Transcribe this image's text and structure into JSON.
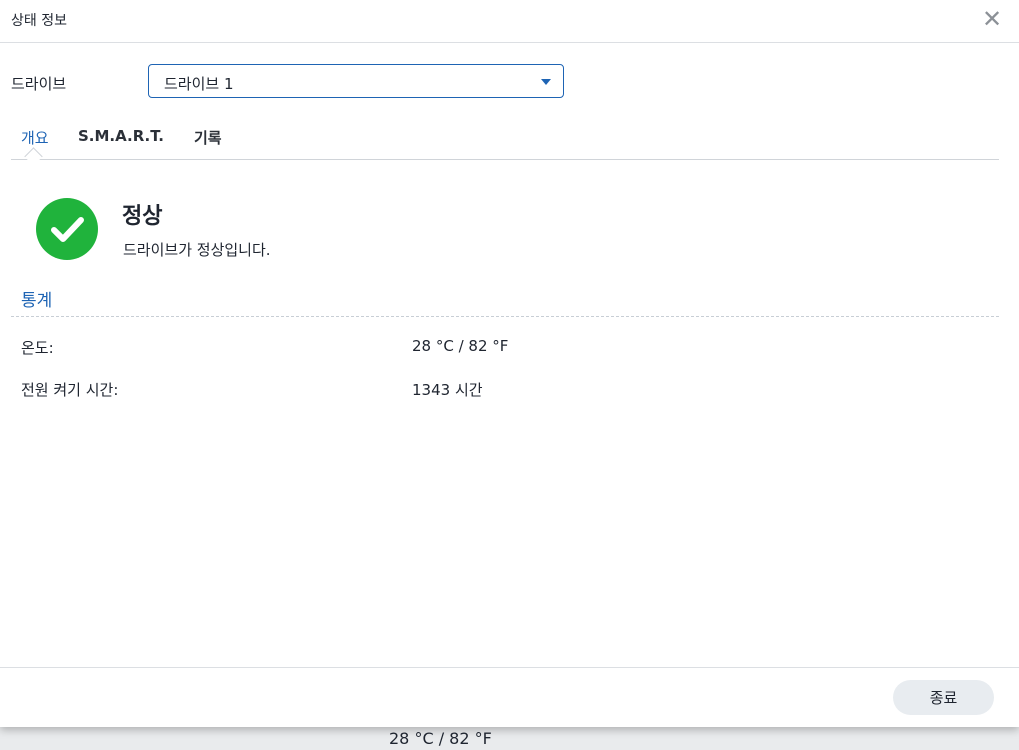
{
  "dialog": {
    "title": "상태 정보",
    "close_icon": "close-icon"
  },
  "drive": {
    "label": "드라이브",
    "selected": "드라이브 1"
  },
  "tabs": [
    {
      "label": "개요",
      "active": true
    },
    {
      "label": "S.M.A.R.T.",
      "active": false
    },
    {
      "label": "기록",
      "active": false
    }
  ],
  "status": {
    "icon": "check-circle-icon",
    "title": "정상",
    "description": "드라이브가 정상입니다."
  },
  "statistics": {
    "title": "통계",
    "rows": [
      {
        "label": "온도:",
        "value": "28 °C / 82 °F"
      },
      {
        "label": "전원 켜기 시간:",
        "value": "1343 시간"
      }
    ]
  },
  "footer": {
    "close_label": "종료"
  },
  "background": {
    "visible_text": "28 °C / 82 °F"
  },
  "colors": {
    "accent": "#1e64b4",
    "success": "#20b33c"
  }
}
